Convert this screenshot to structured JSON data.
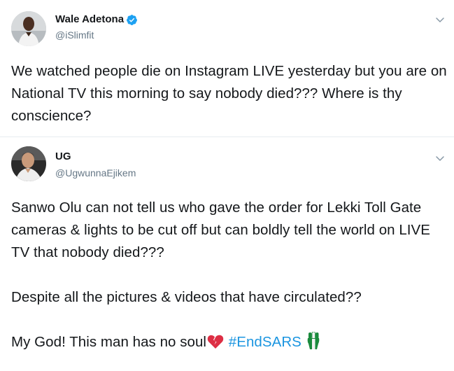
{
  "tweets": [
    {
      "author": {
        "display_name": "Wale Adetona",
        "handle": "@iSlimfit",
        "verified": true
      },
      "text": "We watched people die on Instagram LIVE yesterday but you are on National TV this morning to say nobody died??? Where is thy conscience?"
    },
    {
      "author": {
        "display_name": "UG",
        "handle": "@UgwunnaEjikem",
        "verified": false
      },
      "paragraphs": [
        "Sanwo Olu can not tell us who gave the order for Lekki Toll Gate cameras & lights to be cut off but can boldly tell the world on LIVE TV that nobody died???",
        "Despite all the pictures & videos that have circulated??",
        "My God! This man has no soul"
      ],
      "hashtag": "#EndSARS"
    }
  ],
  "colors": {
    "text": "#14171a",
    "secondary": "#657786",
    "link": "#1b95e0",
    "verified": "#1da1f2",
    "divider": "#e6ecf0"
  },
  "icons": {
    "verified": "verified-badge-icon",
    "menu": "chevron-down-icon",
    "broken_heart": "broken-heart-emoji",
    "flag_fist": "green-white-raised-fist-emoji"
  }
}
